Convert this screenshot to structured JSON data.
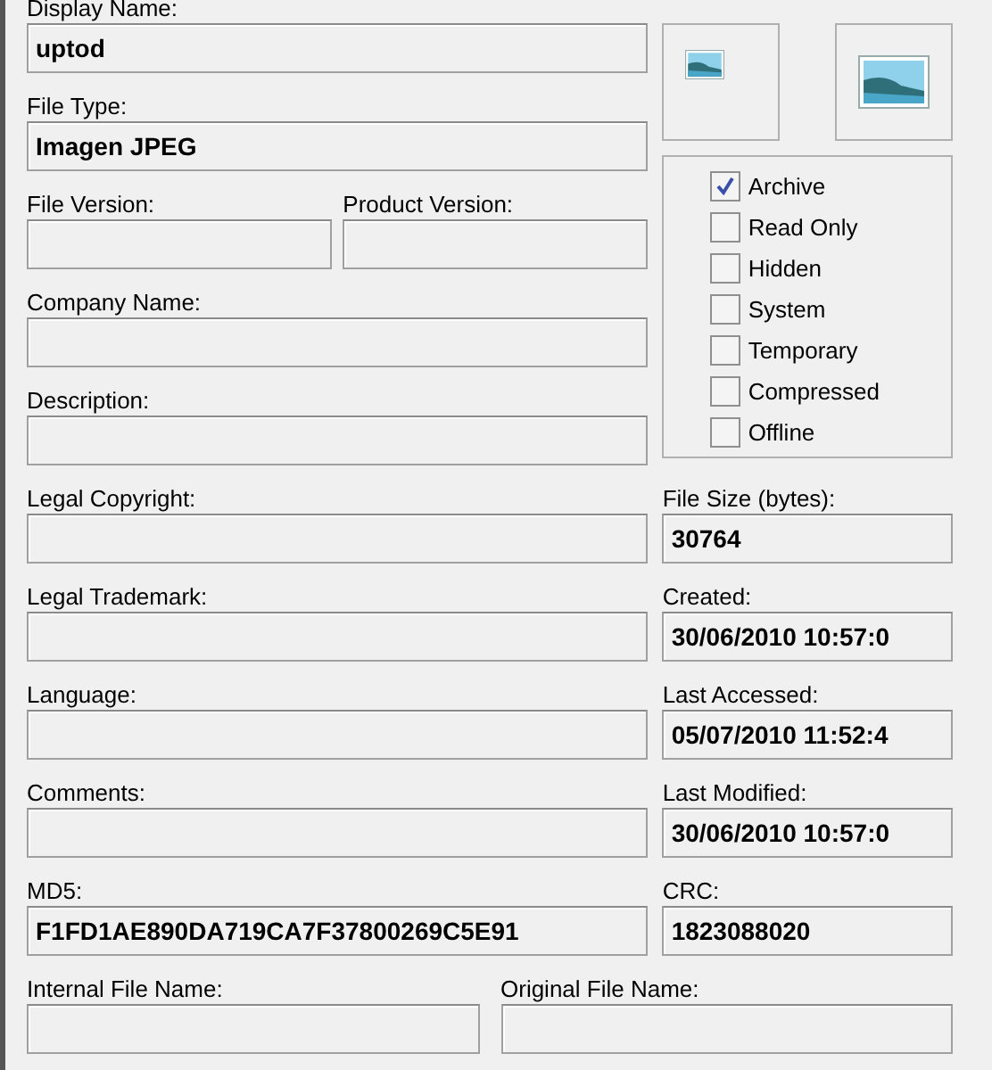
{
  "general": [
    {
      "kind": "single",
      "label": "Display Name:",
      "value": "uptod"
    },
    {
      "kind": "single",
      "label": "File Type:",
      "value": "Imagen JPEG"
    },
    {
      "kind": "pair",
      "fields": [
        {
          "label": "File Version:"
        },
        {
          "label": "Product Version:"
        }
      ]
    },
    {
      "kind": "single",
      "label": "Company Name:"
    },
    {
      "kind": "single",
      "label": "Description:"
    }
  ],
  "attributes": [
    {
      "label": "Archive",
      "checked": true
    },
    {
      "label": "Read Only",
      "checked": false
    },
    {
      "label": "Hidden",
      "checked": false
    },
    {
      "label": "System",
      "checked": false
    },
    {
      "label": "Temporary",
      "checked": false
    },
    {
      "label": "Compressed",
      "checked": false
    },
    {
      "label": "Offline",
      "checked": false
    }
  ],
  "rows": [
    {
      "left": {
        "label": "Legal Copyright:"
      },
      "right": {
        "label": "File Size (bytes):",
        "value": "30764"
      }
    },
    {
      "left": {
        "label": "Legal Trademark:"
      },
      "right": {
        "label": "Created:",
        "value": "30/06/2010 10:57:0"
      }
    },
    {
      "left": {
        "label": "Language:"
      },
      "right": {
        "label": "Last Accessed:",
        "value": "05/07/2010 11:52:4"
      }
    },
    {
      "left": {
        "label": "Comments:"
      },
      "right": {
        "label": "Last Modified:",
        "value": "30/06/2010 10:57:0"
      }
    },
    {
      "left": {
        "label": "MD5:",
        "value": "F1FD1AE890DA719CA7F37800269C5E91"
      },
      "right": {
        "label": "CRC:",
        "value": "1823088020"
      }
    }
  ],
  "bottom": [
    {
      "label": "Internal File Name:"
    },
    {
      "label": "Original File Name:"
    }
  ]
}
